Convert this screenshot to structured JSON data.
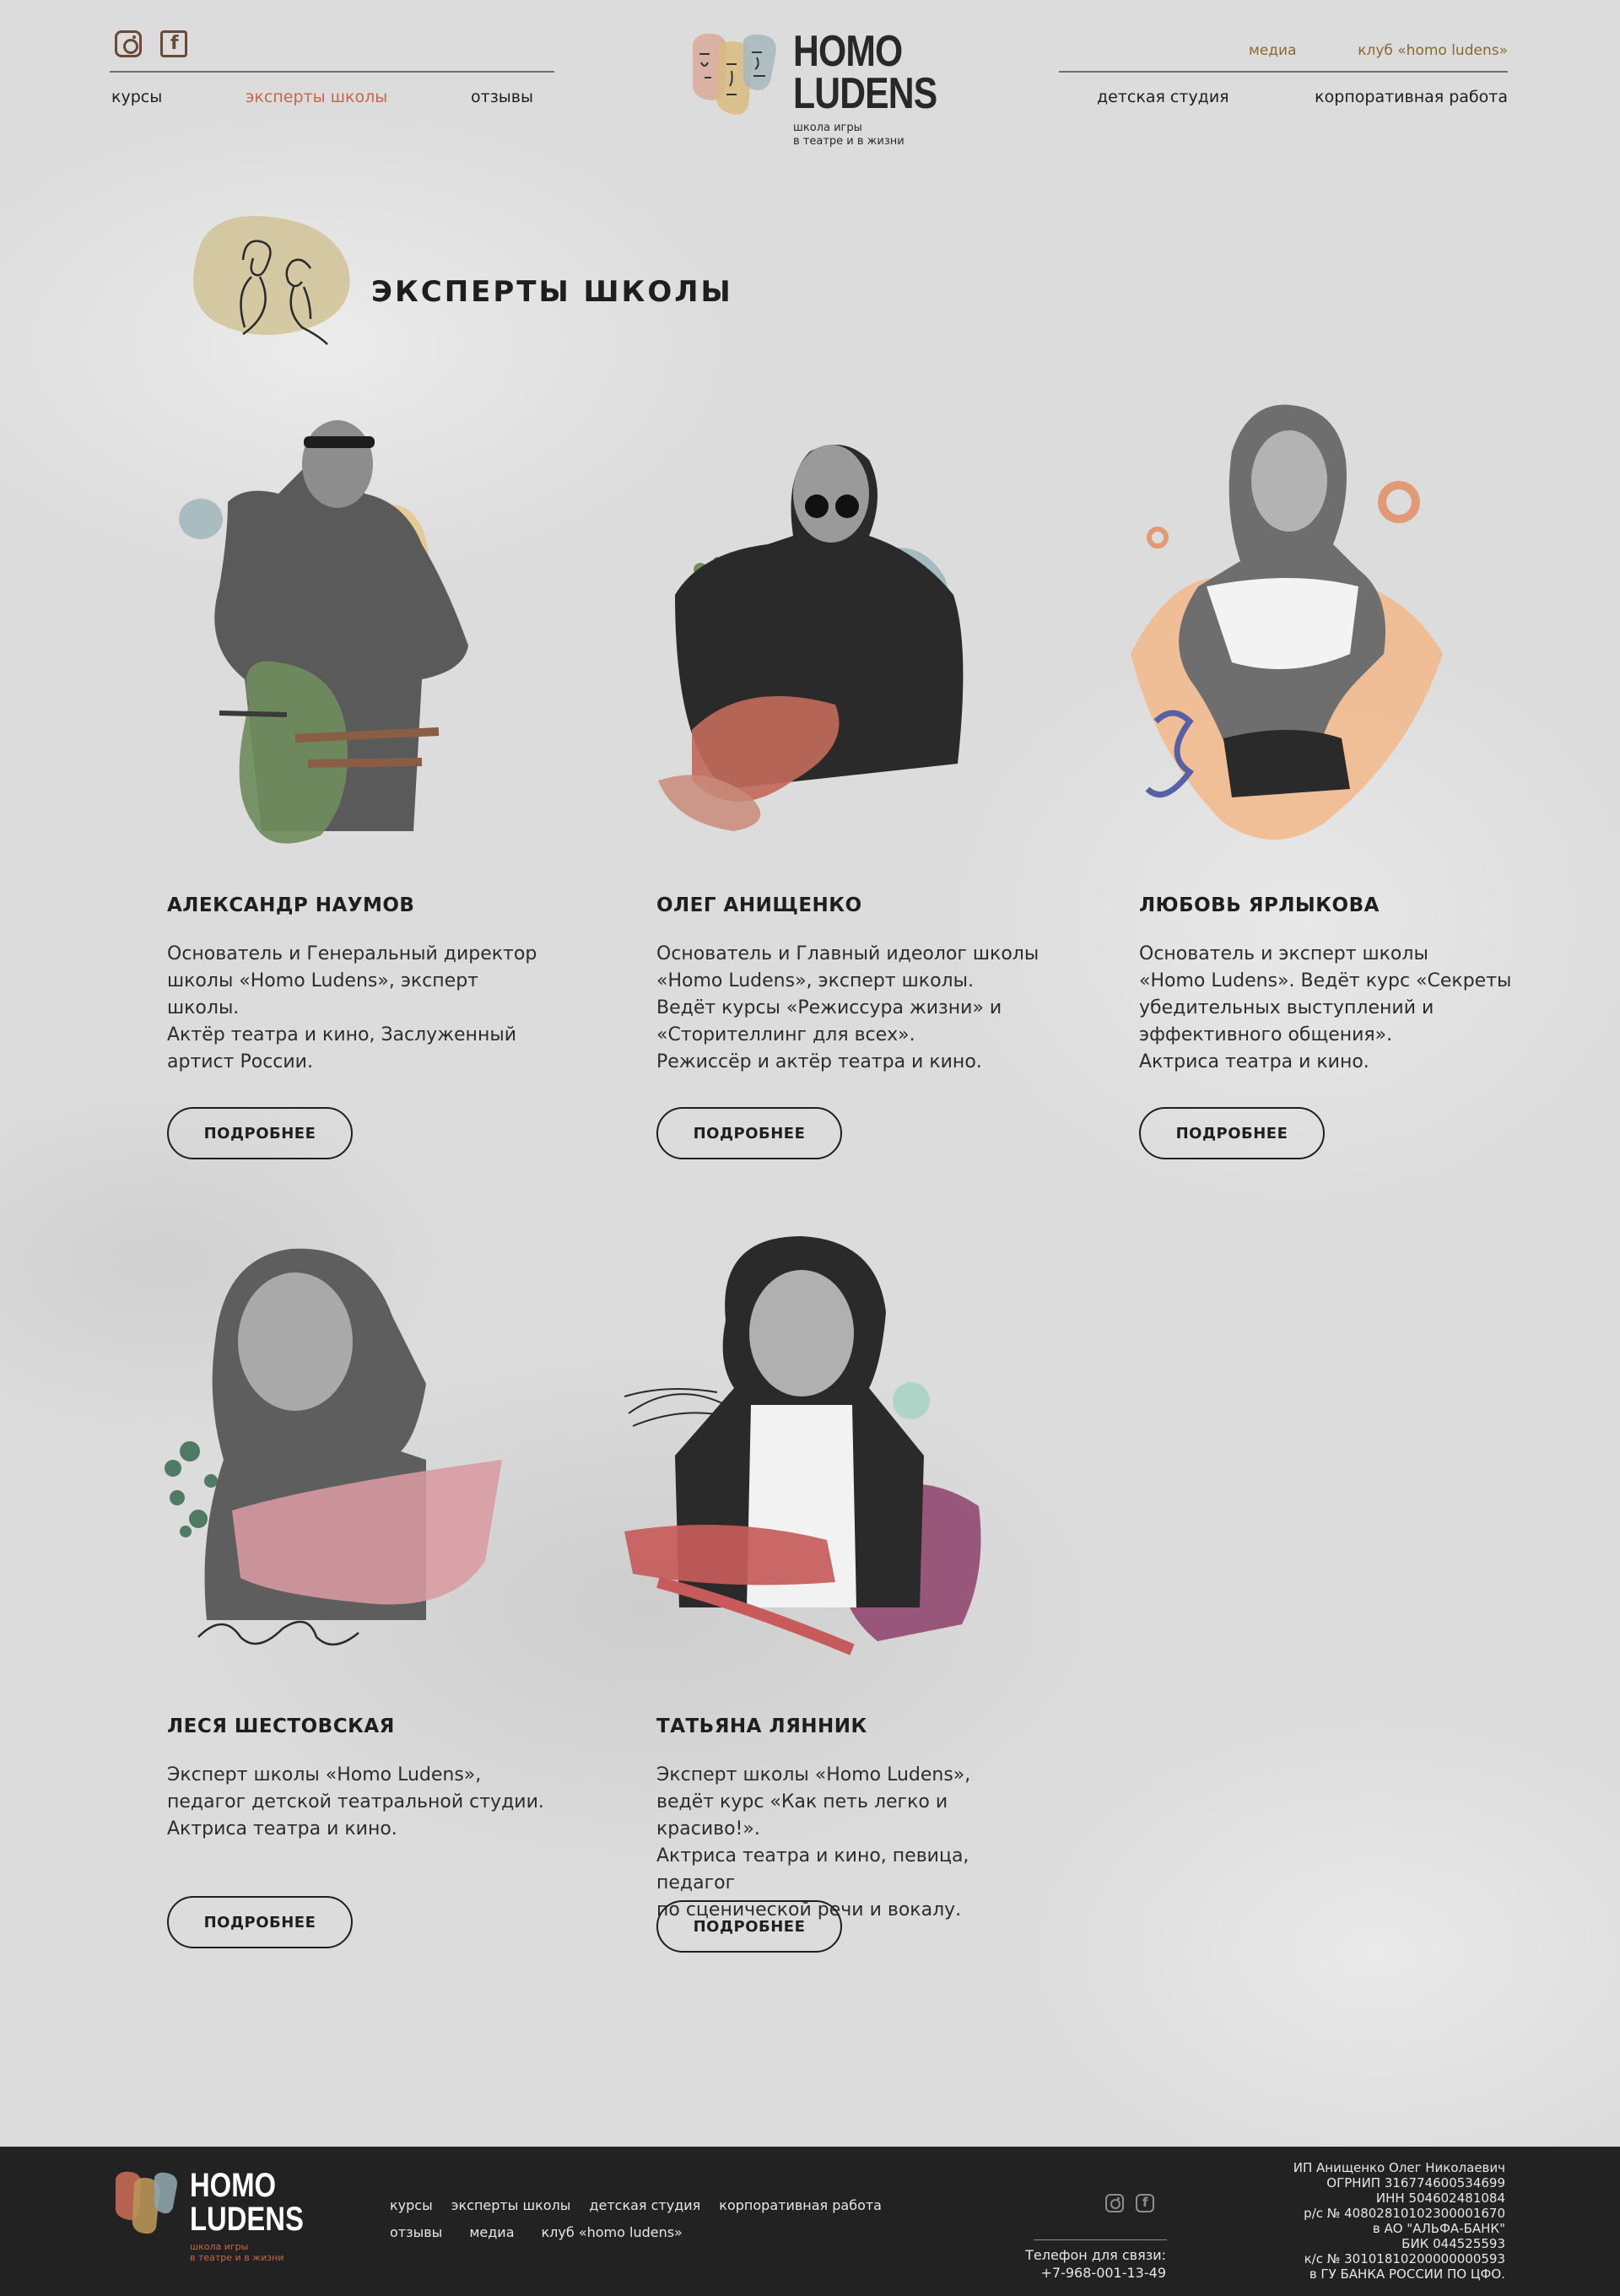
{
  "header": {
    "social": [
      {
        "name": "instagram",
        "icon": "instagram-icon"
      },
      {
        "name": "facebook",
        "icon": "facebook-icon"
      }
    ],
    "nav_left": [
      "курсы",
      "эксперты школы",
      "отзывы"
    ],
    "nav_left_active": "эксперты школы",
    "nav_top_right": [
      "медиа",
      "клуб «homo ludens»"
    ],
    "nav_right": [
      "детская студия",
      "корпоративная работа"
    ],
    "logo": {
      "line1": "HOMO",
      "line2": "LUDENS",
      "tagline": "школа игры\nв театре и в жизни"
    }
  },
  "page_title": "ЭКСПЕРТЫ ШКОЛЫ",
  "button_label": "ПОДРОБНЕЕ",
  "experts": [
    {
      "name": "АЛЕКСАНДР НАУМОВ",
      "bio": "Основатель и Генеральный директор\nшколы «Homo Ludens», эксперт школы.\nАктёр театра и кино, Заслуженный\nартист России."
    },
    {
      "name": "ОЛЕГ АНИЩЕНКО",
      "bio": "Основатель и Главный идеолог школы\n«Homo Ludens», эксперт школы.\nВедёт курсы «Режиссура жизни» и\n«Сторителлинг для всех».\nРежиссёр и актёр театра и кино."
    },
    {
      "name": "ЛЮБОВЬ ЯРЛЫКОВА",
      "bio": "Основатель и эксперт школы\n«Homo Ludens». Ведёт курс «Секреты\nубедительных выступлений и\nэффективного общения».\nАктриса театра и кино."
    },
    {
      "name": "ЛЕСЯ ШЕСТОВСКАЯ",
      "bio": "Эксперт школы «Homo Ludens»,\nпедагог детской театральной студии.\nАктриса театра и кино."
    },
    {
      "name": "ТАТЬЯНА ЛЯННИК",
      "bio": "Эксперт школы «Homo Ludens»,\nведёт курс «Как петь легко и красиво!».\nАктриса театра и кино, певица, педагог\nпо сценической речи и вокалу."
    }
  ],
  "footer": {
    "logo": {
      "line1": "HOMO",
      "line2": "LUDENS",
      "tagline": "школа игры\nв театре и в жизни"
    },
    "nav_row1": [
      "курсы",
      "эксперты школы",
      "детская студия",
      "корпоративная работа"
    ],
    "nav_row2": [
      "отзывы",
      "медиа",
      "клуб «homo ludens»"
    ],
    "phone_label": "Телефон для связи:",
    "phone": "+7-968-001-13-49",
    "legal": "ИП Анищенко Олег Николаевич\nОГРНИП 316774600534699\nИНН 504602481084\nр/с № 40802810102300001670\nв АО \"АЛЬФА-БАНК\"\nБИК 044525593\nк/с № 30101810200000000593\nв ГУ БАНКА РОССИИ ПО ЦФО."
  },
  "colors": {
    "accent_terracotta": "#c7664a",
    "accent_gold": "#8a6a2b",
    "footer_bg": "#222222",
    "text": "#1e1e1e"
  }
}
